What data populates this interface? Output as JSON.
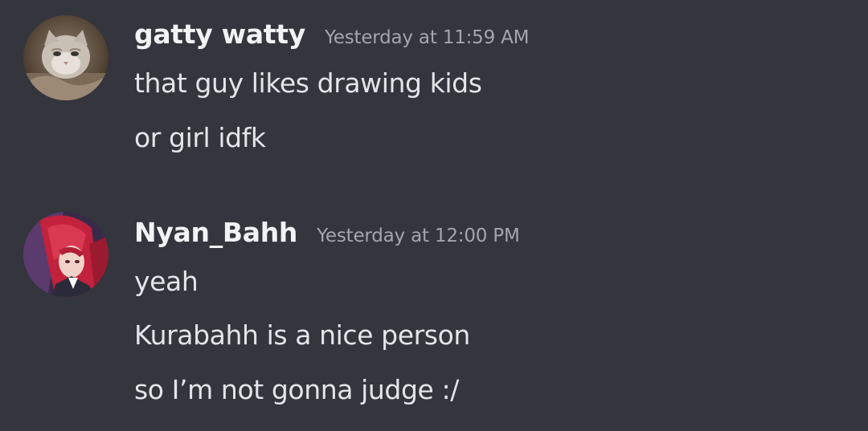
{
  "messages": [
    {
      "username": "gatty watty",
      "timestamp": "Yesterday at 11:59 AM",
      "avatar_icon": "cat-avatar",
      "lines": [
        "that guy likes drawing kids",
        "or girl idfk"
      ]
    },
    {
      "username": "Nyan_Bahh",
      "timestamp": "Yesterday at 12:00 PM",
      "avatar_icon": "anime-avatar",
      "lines": [
        "yeah",
        "Kurabahh is a nice person",
        "so I’m not gonna judge :/"
      ]
    }
  ]
}
